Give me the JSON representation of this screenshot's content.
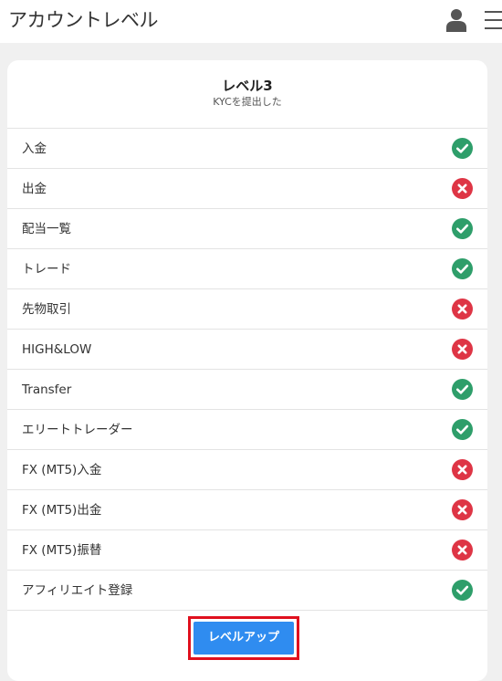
{
  "header": {
    "title": "アカウントレベル",
    "user_icon": "user-icon",
    "menu_icon": "menu-icon"
  },
  "level": {
    "title": "レベル3",
    "subtitle": "KYCを提出した"
  },
  "colors": {
    "ok": "#2e9e6a",
    "ng": "#de3545",
    "button": "#2f8cf0",
    "button_highlight_border": "#e0101e"
  },
  "features": [
    {
      "label": "入金",
      "status": "ok"
    },
    {
      "label": "出金",
      "status": "ng"
    },
    {
      "label": "配当一覧",
      "status": "ok"
    },
    {
      "label": "トレード",
      "status": "ok"
    },
    {
      "label": "先物取引",
      "status": "ng"
    },
    {
      "label": "HIGH&LOW",
      "status": "ng"
    },
    {
      "label": "Transfer",
      "status": "ok"
    },
    {
      "label": "エリートトレーダー",
      "status": "ok"
    },
    {
      "label": "FX (MT5)入金",
      "status": "ng"
    },
    {
      "label": "FX (MT5)出金",
      "status": "ng"
    },
    {
      "label": "FX (MT5)振替",
      "status": "ng"
    },
    {
      "label": "アフィリエイト登録",
      "status": "ok"
    }
  ],
  "action": {
    "level_up_label": "レベルアップ"
  }
}
